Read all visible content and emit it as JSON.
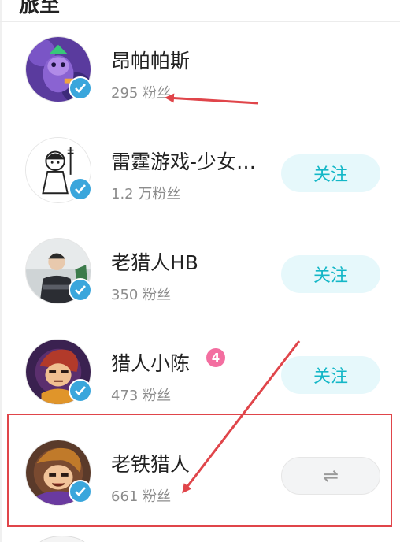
{
  "header": {
    "title": "旅至"
  },
  "users": [
    {
      "name": "昂帕帕斯",
      "fans": "295 粉丝",
      "button": ""
    },
    {
      "name": "雷霆游戏-少女…",
      "fans": "1.2 万粉丝",
      "button": "关注"
    },
    {
      "name": "老猎人HB",
      "fans": "350 粉丝",
      "button": "关注"
    },
    {
      "name": "猎人小陈",
      "fans": "473 粉丝",
      "button": "关注",
      "level": "4"
    },
    {
      "name": "老铁猎人",
      "fans": "661 粉丝",
      "button": "⇌"
    }
  ],
  "colors": {
    "accent": "#14b7c7",
    "follow_bg": "#e6f8fb",
    "verify": "#3aa6dc",
    "annotation": "#e0454a",
    "level_badge": "#f36ea0"
  },
  "icons": [
    "verified-badge-icon",
    "mutual-follow-icon",
    "level-badge-icon",
    "arrow-annotation"
  ]
}
